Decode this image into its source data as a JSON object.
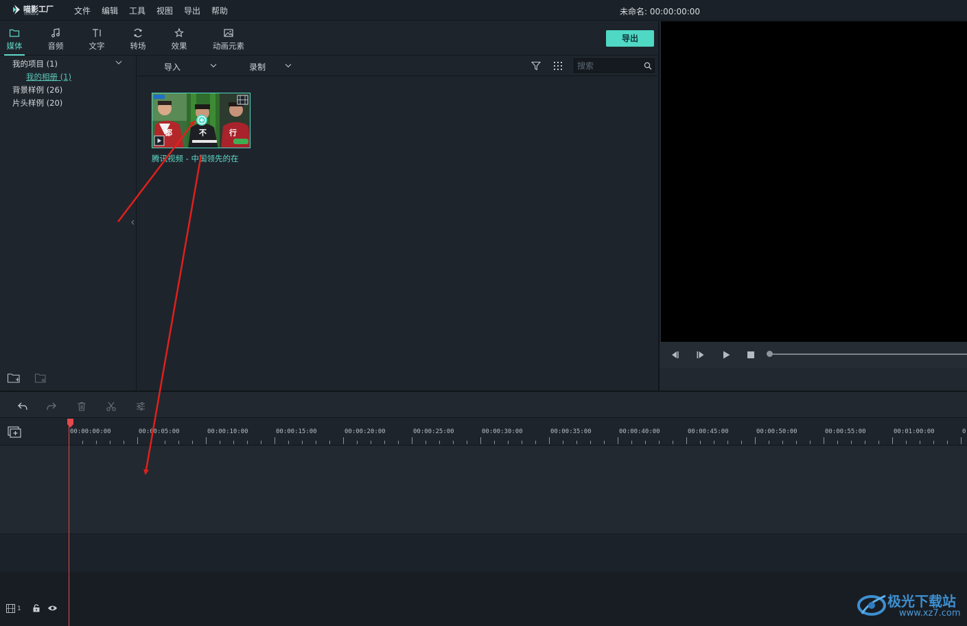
{
  "app": {
    "logo_text": "喵影工厂",
    "logo_sub": "filmora",
    "project_title": "未命名: 00:00:00:00"
  },
  "menu": [
    "文件",
    "编辑",
    "工具",
    "视图",
    "导出",
    "帮助"
  ],
  "tabs": [
    {
      "label": "媒体",
      "icon": "folder-icon",
      "active": true
    },
    {
      "label": "音频",
      "icon": "music-note-icon",
      "active": false
    },
    {
      "label": "文字",
      "icon": "text-icon",
      "active": false
    },
    {
      "label": "转场",
      "icon": "transition-icon",
      "active": false
    },
    {
      "label": "效果",
      "icon": "effects-icon",
      "active": false
    },
    {
      "label": "动画元素",
      "icon": "image-icon",
      "active": false
    }
  ],
  "export_label": "导出",
  "tree": {
    "items": [
      {
        "label": "我的项目 (1)",
        "level": 0
      },
      {
        "label": "我的相册 (1)",
        "level": 1
      },
      {
        "label": "背景样例 (26)",
        "level": 0
      },
      {
        "label": "片头样例 (20)",
        "level": 0
      }
    ]
  },
  "media_toolbar": {
    "import_label": "导入",
    "record_label": "录制",
    "search_placeholder": "搜索"
  },
  "media": {
    "items": [
      {
        "caption": "腾讯视频 - 中国领先的在",
        "thumb_chars": [
          "都",
          "不",
          "行"
        ]
      }
    ]
  },
  "timeline": {
    "ticks": [
      "00:00:00:00",
      "00:00:05:00",
      "00:00:10:00",
      "00:00:15:00",
      "00:00:20:00",
      "00:00:25:00",
      "00:00:30:00",
      "00:00:35:00",
      "00:00:40:00",
      "00:00:45:00",
      "00:00:50:00",
      "00:00:55:00",
      "00:01:00:00",
      "0"
    ],
    "track_number": "1"
  },
  "watermark": {
    "text": "极光下载站",
    "url": "www.xz7.com"
  },
  "colors": {
    "accent": "#4fd8c4",
    "playhead": "#e5484d",
    "annotation_arrow": "#e0201c"
  }
}
